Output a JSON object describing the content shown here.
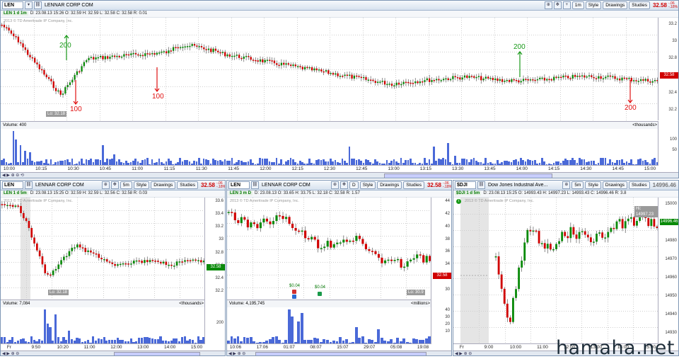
{
  "top": {
    "symbol": "LEN",
    "name": "LENNAR CORP COM",
    "interval": "1m",
    "price": "32.58",
    "change": "-.06 -.18%",
    "quote": "D: 23.08.13 15:26   O: 32.59   H: 32.59   L: 32.58   C: 32.58   R: 0.01",
    "tag": "LEN 1 d 1m",
    "copyright": "2013 © TD Ameritrade IP Company, Inc.",
    "yticks": [
      "33.2",
      "33",
      "32.8",
      "32.6",
      "32.4",
      "32.2"
    ],
    "last": "32.58",
    "low_label": "Lo: 32.18",
    "volume_label": "Volume: 400",
    "volume_unit": "<thousands>",
    "vticks": [
      "100",
      "50"
    ],
    "xticks": [
      "10:00",
      "10:15",
      "10:30",
      "10:45",
      "11:00",
      "11:15",
      "11:30",
      "11:45",
      "12:00",
      "12:15",
      "12:30",
      "12:45",
      "13:00",
      "13:15",
      "13:30",
      "13:45",
      "14:00",
      "14:15",
      "14:30",
      "14:45",
      "15:00"
    ],
    "annotations": [
      {
        "text": "200",
        "color": "green"
      },
      {
        "text": "100",
        "color": "red"
      },
      {
        "text": "100",
        "color": "red"
      },
      {
        "text": "200",
        "color": "green"
      },
      {
        "text": "200",
        "color": "red"
      }
    ]
  },
  "p1": {
    "symbol": "LEN",
    "name": "LENNAR CORP COM",
    "interval": "5m",
    "price": "32.58",
    "change": "-.06 -.18%",
    "tag": "LEN 1 d 5m",
    "quote": "D: 23.08.13 15:25   O: 32.59   H: 32.59   L: 32.56   C: 32.58   R: 0.03",
    "copyright": "2013 © TD Ameritrade IP Company, Inc.",
    "yticks": [
      "33.6",
      "33.4",
      "33.2",
      "33",
      "32.8",
      "32.6",
      "32.4",
      "32.2"
    ],
    "last": "32.58",
    "low_label": "Lo: 32.18",
    "volume_label": "Volume: 7,084",
    "volume_unit": "<thousands>",
    "vticks": [
      "200"
    ],
    "xticks": [
      "Fr",
      "9:50",
      "10:20",
      "11:00",
      "12:00",
      "13:00",
      "14:00",
      "15:00"
    ]
  },
  "p2": {
    "symbol": "LEN",
    "name": "LENNAR CORP COM",
    "interval": "D",
    "price": "32.58",
    "change": "-.06 -.18%",
    "tag": "LEN 3 m D",
    "quote": "D: 23.08.13   O: 33.65   H: 33.75   L: 32.18   C: 32.58   R: 1.57",
    "copyright": "2013 © TD Ameritrade IP Company, Inc.",
    "yticks": [
      "44",
      "42",
      "40",
      "38",
      "36",
      "34",
      "32",
      "30"
    ],
    "last": "32.58",
    "low_label": "Lo: 30.9",
    "dividends": [
      "$0.04",
      "$0.04"
    ],
    "volume_label": "Volume: 4,195,745",
    "volume_unit": "<millions>",
    "vticks": [
      "40",
      "30",
      "20",
      "10"
    ],
    "xticks": [
      "10:06",
      "17:06",
      "01:07",
      "08:07",
      "15:07",
      "29:07",
      "05:08",
      "19:08"
    ]
  },
  "p3": {
    "symbol": "$DJI",
    "name": "Dow Jones Industrial Ave...",
    "interval": "5m",
    "price": "14996.46",
    "tag": "$DJI 1 d 5m",
    "quote": "D: 23.08.13 15:25   O: 14993.43   H: 14997.23   L: 14993.43   C: 14996.46   R: 3.8",
    "copyright": "2013 © TD Ameritrade IP Company, Inc.",
    "yticks": [
      "15000",
      "14990",
      "14980",
      "14970",
      "14960",
      "14950",
      "14940",
      "14930"
    ],
    "last": "14996.46",
    "hi_label": "Hi: 14997.23",
    "xticks": [
      "Fr",
      "9:00",
      "10:00",
      "11:00",
      "12:00",
      "13:00",
      "14:00",
      "15:00"
    ]
  },
  "buttons": {
    "style": "Style",
    "drawings": "Drawings",
    "studies": "Studies"
  },
  "watermark": "hamaha.net",
  "colors": {
    "up": "#0a8a0a",
    "down": "#d00000",
    "volume": "#4a69d8"
  }
}
